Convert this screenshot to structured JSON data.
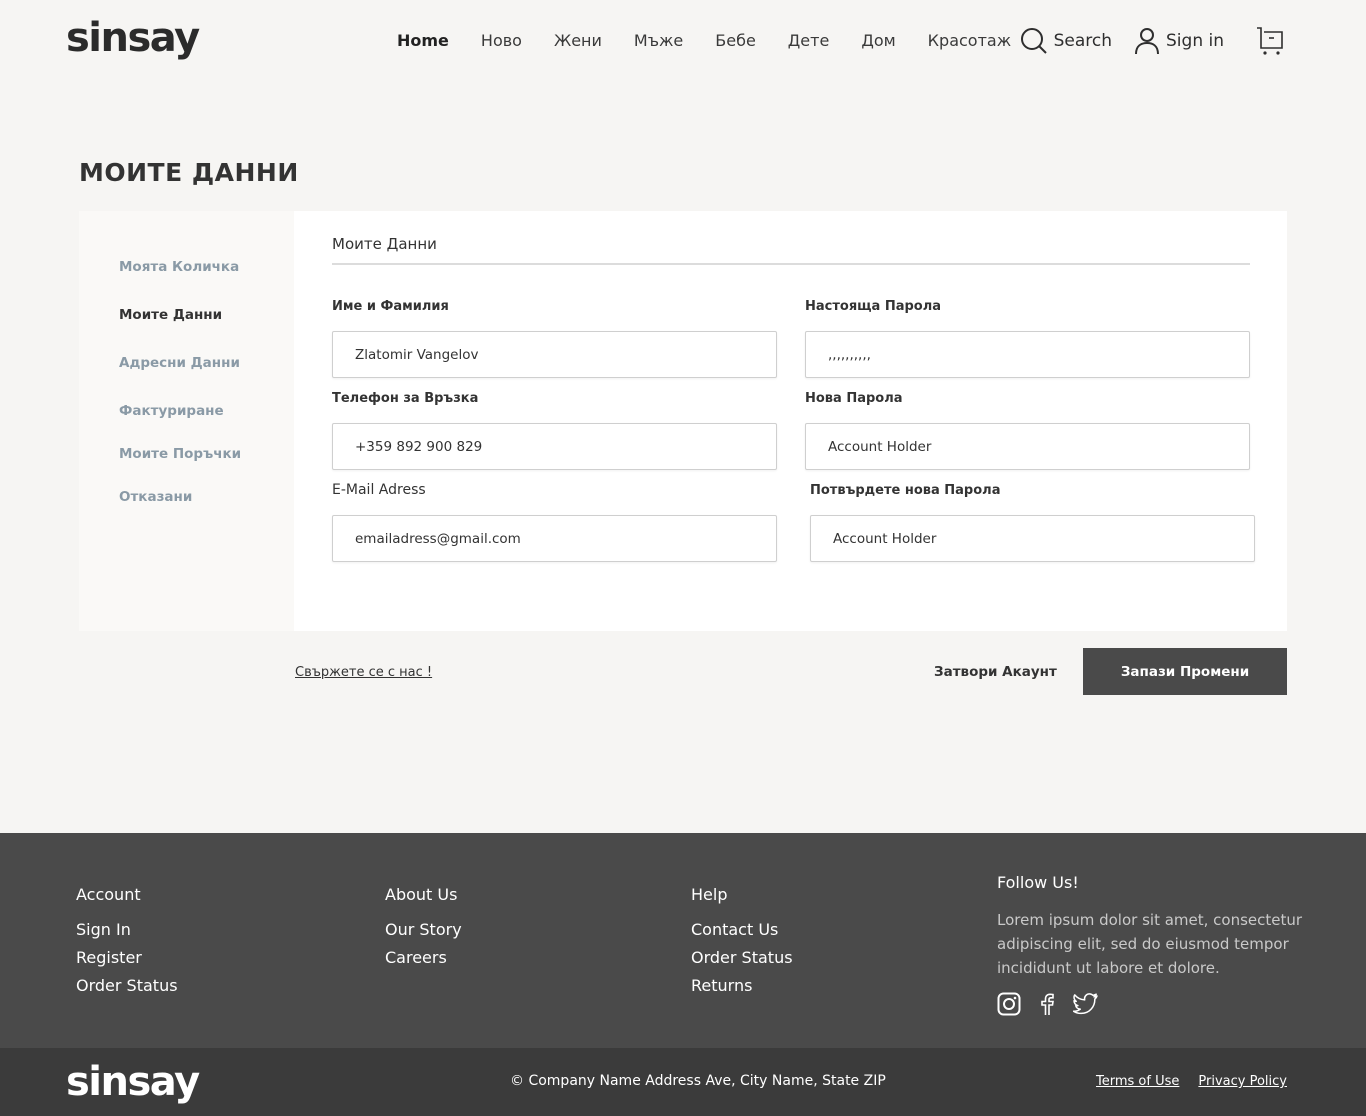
{
  "brand": {
    "logo_text": "sinsay"
  },
  "nav": {
    "items": [
      "Home",
      "Ново",
      "Жени",
      "Мъже",
      "Бебе",
      "Дете",
      "Дом",
      "Красотаж"
    ]
  },
  "header_tools": {
    "search_label": "Search",
    "signin_label": "Sign in"
  },
  "page": {
    "title": "МОИТЕ ДАННИ"
  },
  "sidebar": {
    "items": [
      "Моята Количка",
      "Моите Данни",
      "Адресни Данни",
      "Фактуриране",
      "Моите Поръчки",
      "Отказани"
    ],
    "active": "Моите Данни"
  },
  "form": {
    "section_title": "Моите Данни",
    "name_label": "Име и Фамилия",
    "name_value": "Zlatomir Vangelov",
    "current_password_label": "Настояща Парола",
    "current_password_value": ",,,,,,,,,,",
    "phone_label": "Телефон за Връзка",
    "phone_value": "+359 892 900 829",
    "new_password_label": "Нова Парола",
    "new_password_value": "Account Holder",
    "email_label": "E-Mail Adress",
    "email_value": "emailadress@gmail.com",
    "confirm_password_label": "Потвърдете нова Парола",
    "confirm_password_value": "Account Holder"
  },
  "actions": {
    "contact_link": "Свържете се с нас !",
    "close_account": "Затвори Акаунт",
    "save": "Запази Промени"
  },
  "footer": {
    "account": {
      "title": "Account",
      "links": [
        "Sign In",
        "Register",
        "Order Status"
      ]
    },
    "about": {
      "title": "About Us",
      "links": [
        "Our Story",
        "Careers"
      ]
    },
    "help": {
      "title": "Help",
      "links": [
        "Contact Us",
        "Order Status",
        "Returns"
      ]
    },
    "follow": {
      "title": "Follow Us!",
      "text": "Lorem ipsum dolor sit amet, consectetur adipiscing elit, sed do eiusmod tempor incididunt ut labore et dolore."
    },
    "copyright": "© Company Name Address Ave, City Name, State ZIP",
    "terms": "Terms of Use",
    "privacy": "Privacy Policy"
  },
  "icons": [
    "search-icon",
    "user-icon",
    "cart-icon",
    "instagram-icon",
    "facebook-icon",
    "twitter-icon"
  ],
  "colors": {
    "background": "#f6f5f3",
    "footer": "#4a4a4a",
    "footer_bottom": "#3b3b3b",
    "primary_button": "#4a4a4a",
    "sidebar_inactive": "#8a9aa6"
  }
}
